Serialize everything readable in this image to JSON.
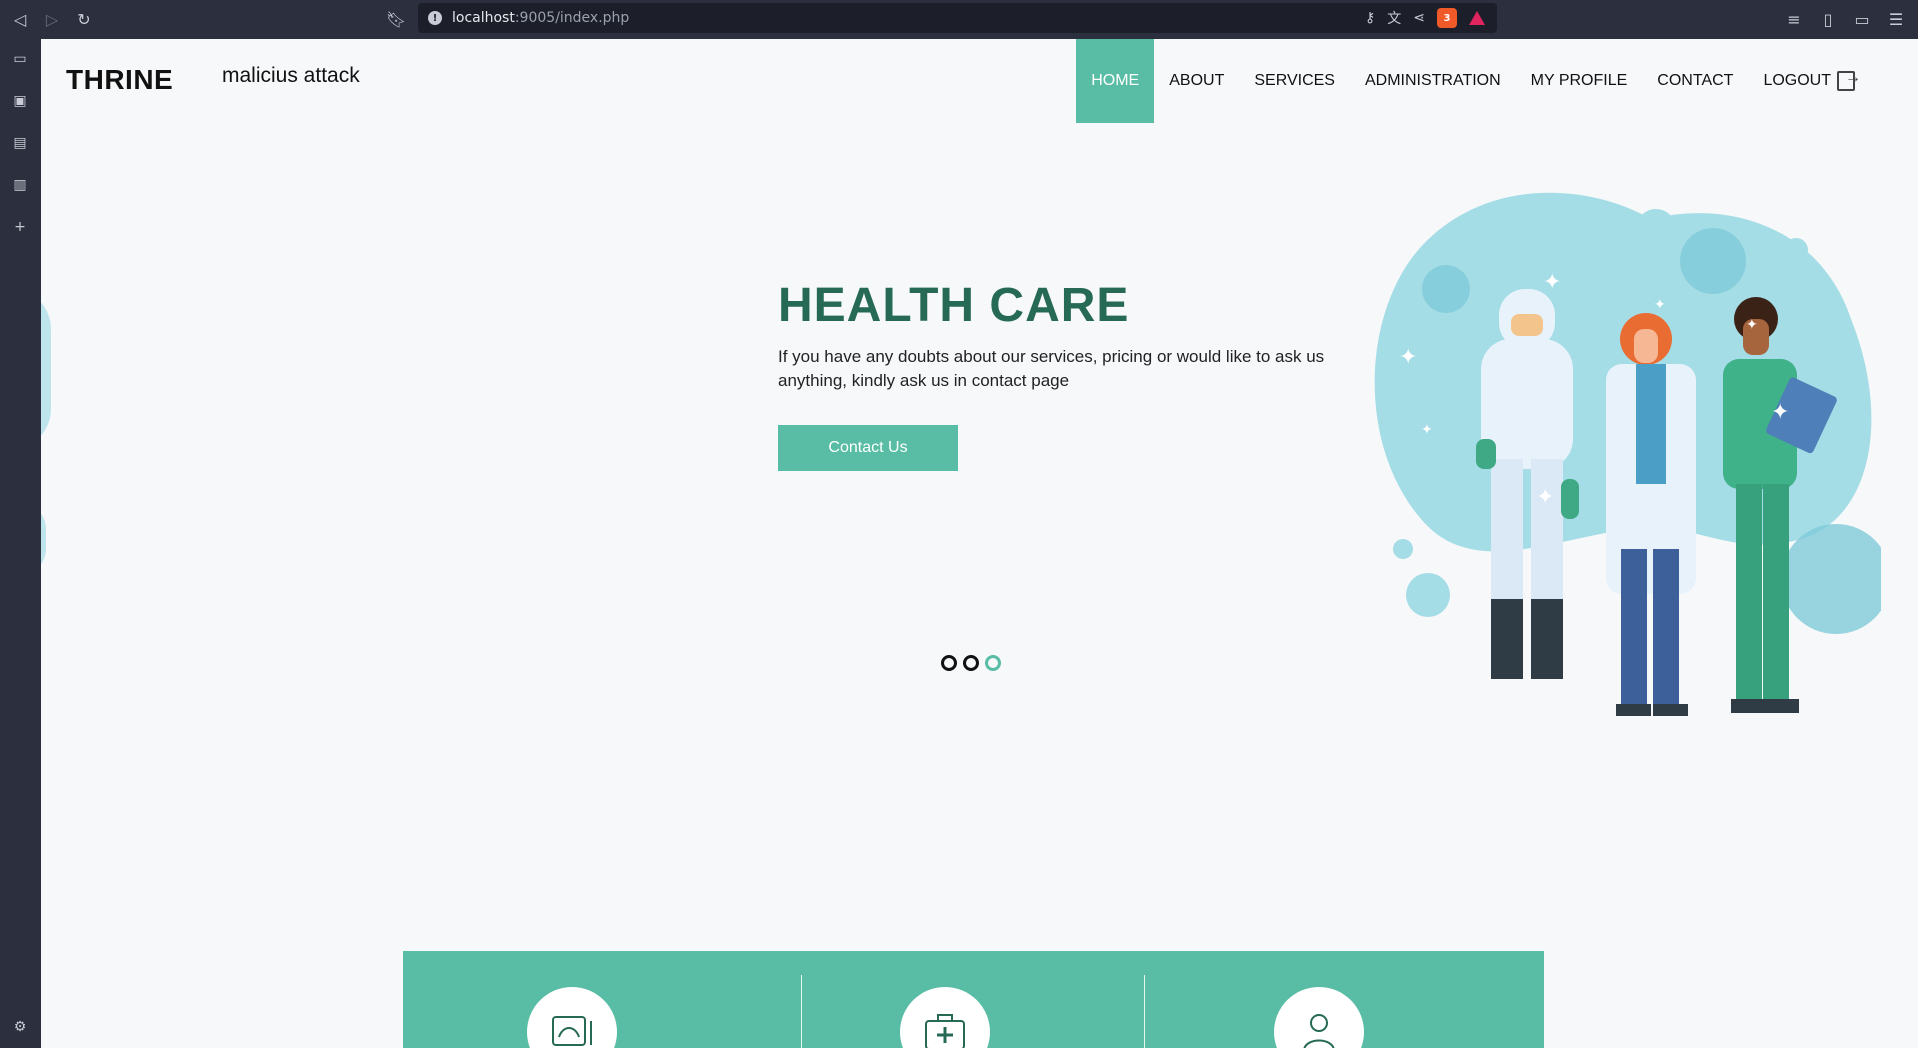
{
  "browser": {
    "url_host": "localhost",
    "url_rest": ":9005/index.php",
    "brave_badge": "3"
  },
  "site": {
    "brand": "THRINE",
    "tagline": "malicius attack"
  },
  "nav": {
    "items": [
      {
        "label": "HOME",
        "active": true
      },
      {
        "label": "ABOUT"
      },
      {
        "label": "SERVICES"
      },
      {
        "label": "ADMINISTRATION"
      },
      {
        "label": "MY PROFILE"
      },
      {
        "label": "CONTACT"
      },
      {
        "label": "LOGOUT"
      }
    ]
  },
  "hero": {
    "title": "HEALTH CARE",
    "text": "If you have any doubts about our services, pricing or would like to ask us anything, kindly ask us in contact page",
    "button_label": "Contact Us"
  },
  "carousel": {
    "slide_count": 3,
    "active_index": 2
  },
  "colors": {
    "accent": "#58bda4",
    "title": "#266a55",
    "illustration_bg": "#a5dde6"
  },
  "features": {
    "icons": [
      "ultrasound-icon",
      "first-aid-kit-icon",
      "doctor-icon"
    ]
  }
}
